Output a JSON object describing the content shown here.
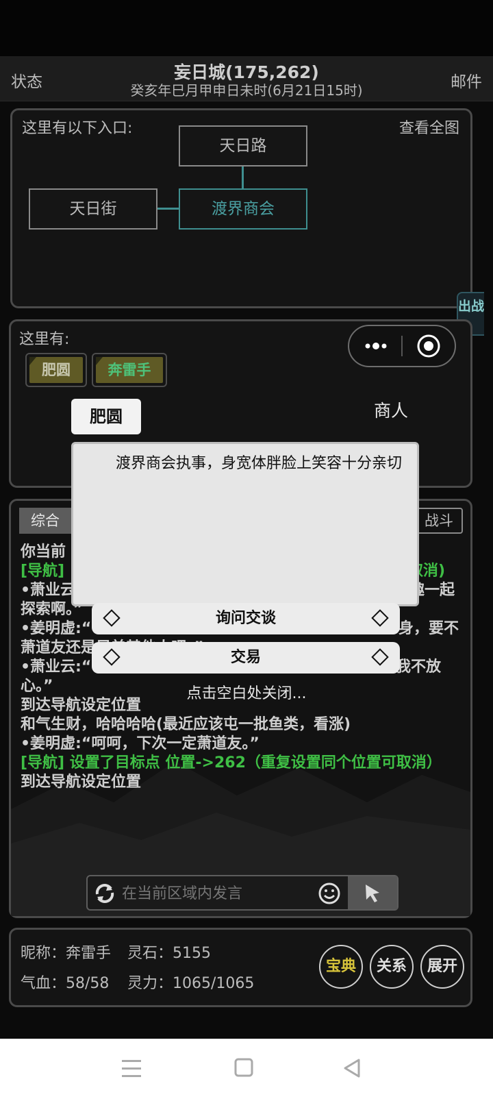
{
  "header": {
    "left_label": "状态",
    "title": "妄日城(175,262)",
    "subtitle": "癸亥年巳月甲申日未时(6月21日15时)",
    "right_label": "邮件"
  },
  "map": {
    "label": "这里有以下入口:",
    "view_all": "查看全图",
    "rooms": [
      "天日路",
      "天日街",
      "渡界商会"
    ]
  },
  "side_tab": "出战",
  "here": {
    "label": "这里有:",
    "npcs": [
      "肥圆",
      "奔雷手"
    ]
  },
  "capsule": {
    "more_icon": "more-dots-icon",
    "close_icon": "target-circle-icon"
  },
  "chat": {
    "tabs": [
      "综合",
      "战斗"
    ],
    "lines": [
      {
        "text": "你当前",
        "color": "#cfcfcf"
      },
      {
        "text": "[导航]",
        "color": "#3fbf45"
      },
      {
        "text": "取消)",
        "color": "#3fbf45"
      },
      {
        "text": "•萧业云",
        "color": "#cfcfcf"
      },
      {
        "text": "趣一起",
        "color": "#cfcfcf"
      },
      {
        "text": "探索啊。”",
        "color": "#cfcfcf"
      },
      {
        "text": "•姜明虚:“",
        "color": "#cfcfcf"
      },
      {
        "text": "身，要不",
        "color": "#cfcfcf"
      },
      {
        "text": "萧道友还是兄弟其他人吧。”",
        "color": "#cfcfcf"
      },
      {
        "text": "•萧业云:“",
        "color": "#cfcfcf"
      },
      {
        "text": "我不放",
        "color": "#cfcfcf"
      },
      {
        "text": "心。”",
        "color": "#cfcfcf"
      },
      {
        "text": "到达导航设定位置",
        "color": "#cfcfcf"
      },
      {
        "text": "和气生财，哈哈哈哈(最近应该屯一批鱼类，看涨)",
        "color": "#cfcfcf"
      },
      {
        "text": "•姜明虚:“呵呵，下次一定萧道友。”",
        "color": "#cfcfcf"
      },
      {
        "text": "[导航] 设置了目标点 位置->262（重复设置同个位置可取消）",
        "color": "#3fbf45"
      },
      {
        "text": "到达导航设定位置",
        "color": "#cfcfcf"
      }
    ],
    "input_placeholder": "在当前区域内发言"
  },
  "stats": {
    "nickname": "昵称：奔雷手",
    "spirit_stone": "灵石：5155",
    "hp": "气血：58/58",
    "mana": "灵力：1065/1065",
    "buttons": [
      "宝典",
      "关系",
      "展开"
    ]
  },
  "popup": {
    "name": "肥圆",
    "role": "商人",
    "description": "渡界商会执事，身宽体胖脸上笑容十分亲切",
    "options": [
      "询问交谈",
      "交易"
    ],
    "close_hint": "点击空白处关闭..."
  },
  "colors": {
    "accent": "#3f8f90",
    "green": "#3fbf45",
    "gold": "#d6c23a"
  }
}
